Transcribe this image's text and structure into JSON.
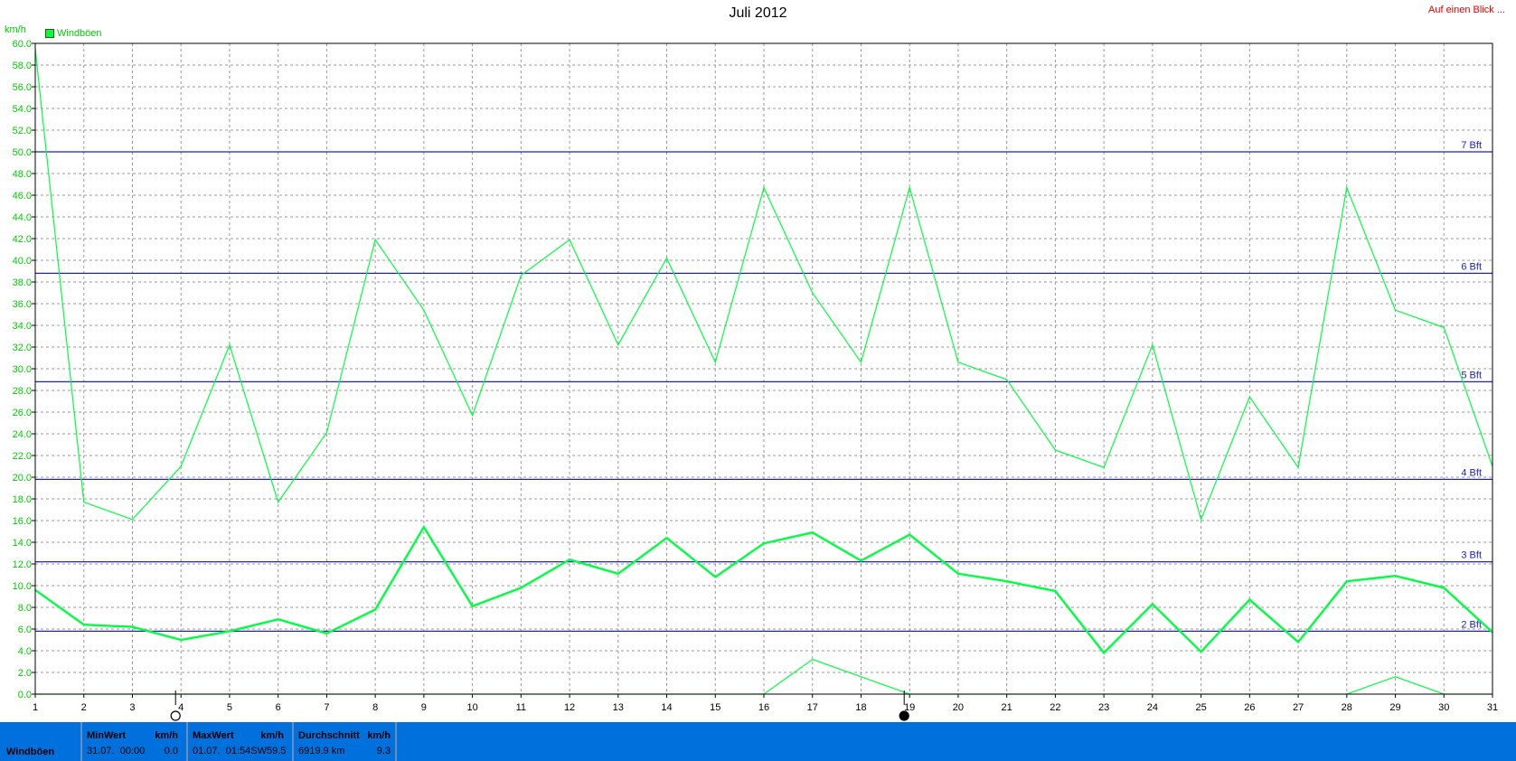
{
  "header": {
    "title": "Juli 2012",
    "link": "Auf einen Blick ..."
  },
  "chart_data": {
    "type": "line",
    "title": "Juli 2012",
    "ylabel": "km/h",
    "xlabel": "",
    "x": [
      1,
      2,
      3,
      4,
      5,
      6,
      7,
      8,
      9,
      10,
      11,
      12,
      13,
      14,
      15,
      16,
      17,
      18,
      19,
      20,
      21,
      22,
      23,
      24,
      25,
      26,
      27,
      28,
      29,
      30,
      31
    ],
    "xlim": [
      1,
      31
    ],
    "ylim": [
      0,
      60
    ],
    "ytick_step": 2,
    "grid": true,
    "legend_position": "top-left",
    "legend": [
      "Windböen"
    ],
    "series": [
      {
        "name": "Windböen",
        "role": "max",
        "color": "#00ff40",
        "values": [
          59.5,
          17.7,
          16.1,
          21.0,
          32.2,
          17.7,
          24.1,
          41.9,
          35.4,
          25.7,
          38.6,
          41.9,
          32.2,
          40.2,
          30.6,
          46.7,
          37.0,
          30.6,
          46.7,
          30.6,
          29.0,
          22.5,
          20.9,
          32.2,
          16.1,
          27.4,
          20.9,
          46.7,
          35.4,
          33.8,
          21.0
        ]
      },
      {
        "name": "",
        "role": "mean",
        "color": "#00ff40",
        "values": [
          9.6,
          6.4,
          6.2,
          5.0,
          5.8,
          6.9,
          5.6,
          7.8,
          15.4,
          8.1,
          9.8,
          12.4,
          11.1,
          14.4,
          10.8,
          13.9,
          14.9,
          12.3,
          14.7,
          11.1,
          10.4,
          9.5,
          3.8,
          8.3,
          3.9,
          8.7,
          4.8,
          10.4,
          10.9,
          9.8,
          5.7
        ]
      },
      {
        "name": "",
        "role": "min",
        "color": "#00ff40",
        "values": [
          0,
          0,
          0,
          0,
          0,
          0,
          0,
          0,
          0,
          0,
          0,
          0,
          0,
          0,
          0,
          0,
          3.2,
          1.6,
          0,
          0,
          0,
          0,
          0,
          0,
          0,
          0,
          0,
          0,
          1.6,
          0,
          0
        ]
      }
    ],
    "reference_lines": [
      {
        "label": "2 Bft",
        "value": 5.8
      },
      {
        "label": "3 Bft",
        "value": 12.2
      },
      {
        "label": "4 Bft",
        "value": 19.8
      },
      {
        "label": "5 Bft",
        "value": 28.8
      },
      {
        "label": "6 Bft",
        "value": 38.8
      },
      {
        "label": "7 Bft",
        "value": 50.0
      }
    ],
    "ref_color": "#2020c0",
    "moon_phases": [
      {
        "day": 4,
        "phase": "full-moon"
      },
      {
        "day": 19,
        "phase": "new-moon"
      }
    ]
  },
  "summary": {
    "row_label": "Windböen",
    "min": {
      "header": "MinWert",
      "unit": "km/h",
      "date": "31.07.",
      "time": "00:00",
      "value": "0.0"
    },
    "max": {
      "header": "MaxWert",
      "unit": "km/h",
      "date": "01.07.",
      "time": "01:54",
      "direction": "SW",
      "value": "59.5"
    },
    "avg": {
      "header": "Durchschnitt",
      "unit": "km/h",
      "distance": "6919.9 km",
      "value": "9.3"
    }
  }
}
